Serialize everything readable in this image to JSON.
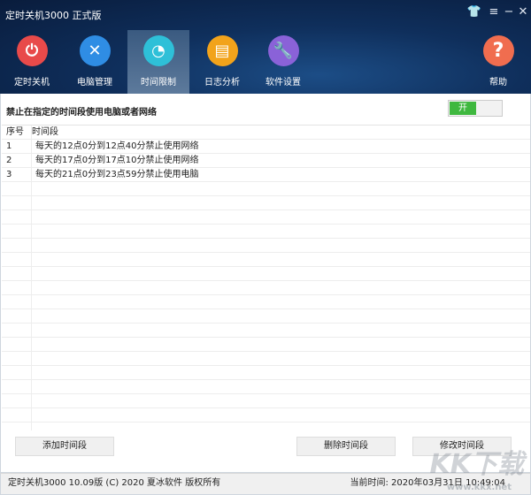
{
  "window": {
    "title": "定时关机3000 正式版",
    "controls": [
      "skin",
      "menu",
      "minimize",
      "close"
    ]
  },
  "nav": {
    "tabs": [
      {
        "label": "定时关机",
        "icon": "power-icon",
        "color": "#e84a4a"
      },
      {
        "label": "电脑管理",
        "icon": "tools-icon",
        "color": "#2f8de4"
      },
      {
        "label": "时间限制",
        "icon": "timer-icon",
        "color": "#2ec0d8",
        "active": true
      },
      {
        "label": "日志分析",
        "icon": "log-icon",
        "color": "#f2a31b"
      },
      {
        "label": "软件设置",
        "icon": "settings-icon",
        "color": "#8a62d8"
      }
    ],
    "help": {
      "label": "帮助",
      "icon": "help-icon",
      "color": "#f06d4f"
    }
  },
  "rule": {
    "label": "禁止在指定的时间段使用电脑或者网络",
    "toggle": "开"
  },
  "table": {
    "headers": [
      "序号",
      "时间段"
    ],
    "rows": [
      [
        "1",
        "每天的12点0分到12点40分禁止使用网络"
      ],
      [
        "2",
        "每天的17点0分到17点10分禁止使用网络"
      ],
      [
        "3",
        "每天的21点0分到23点59分禁止使用电脑"
      ]
    ]
  },
  "buttons": {
    "add": "添加时间段",
    "delete": "删除时间段",
    "edit": "修改时间段"
  },
  "status": {
    "copyright": "定时关机3000 10.09版 (C) 2020  夏冰软件 版权所有",
    "time": "当前时间: 2020年03月31日 10:49:04"
  },
  "watermark": {
    "logo": "KK下载",
    "url": "www.kkx.net"
  }
}
